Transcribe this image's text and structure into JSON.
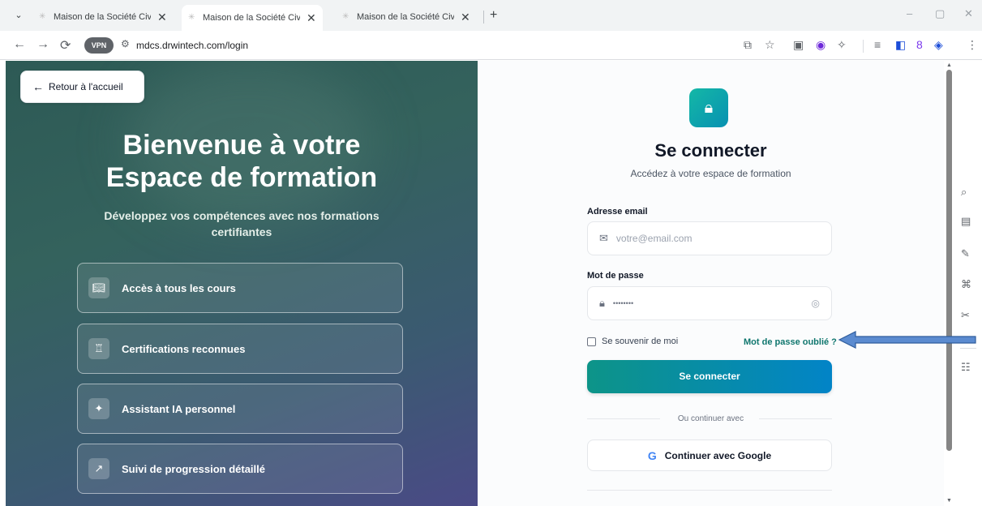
{
  "browser": {
    "tabs": [
      {
        "title": "Maison de la Société Civile - Pla",
        "close": "✕"
      },
      {
        "title": "Maison de la Société Civile - Pla",
        "close": "✕"
      },
      {
        "title": "Maison de la Société Civile - Pla",
        "close": "✕"
      }
    ],
    "new_tab": "+",
    "window_controls": {
      "minimize": "–",
      "restore": "▢",
      "close": "✕"
    },
    "nav": {
      "back": "←",
      "forward": "→",
      "reload": "⟳"
    },
    "vpn_label": "VPN",
    "url": "mdcs.drwintech.com/login"
  },
  "hero": {
    "back_button": "Retour à l'accueil",
    "title_line1": "Bienvenue à votre",
    "title_line2": "Espace de formation",
    "subtitle_line1": "Développez vos compétences avec nos formations",
    "subtitle_line2": "certifiantes",
    "features": [
      {
        "label": "Accès à tous les cours",
        "icon": "book-icon"
      },
      {
        "label": "Certifications reconnues",
        "icon": "award-icon"
      },
      {
        "label": "Assistant IA personnel",
        "icon": "sparkles-icon"
      },
      {
        "label": "Suivi de progression détaillé",
        "icon": "trending-up-icon"
      }
    ]
  },
  "login": {
    "title": "Se connecter",
    "subtitle": "Accédez à votre espace de formation",
    "email_label": "Adresse email",
    "email_placeholder": "votre@email.com",
    "password_label": "Mot de passe",
    "password_value": "••••••••",
    "remember_label": "Se souvenir de moi",
    "forgot_label": "Mot de passe oublié ?",
    "submit_label": "Se connecter",
    "divider_label": "Ou continuer avec",
    "google_label": "Continuer avec Google"
  },
  "colors": {
    "accent": "#0d9488",
    "accent_end": "#0284c7",
    "hero_start": "#2d5a55",
    "hero_end": "#4a4a86",
    "annotation_arrow": "#5b8bd0"
  }
}
